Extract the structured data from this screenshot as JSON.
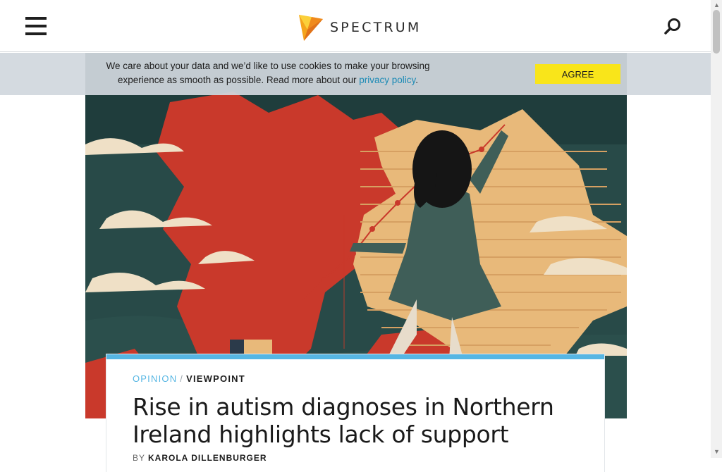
{
  "header": {
    "logo_text": "SPECTRUM",
    "menu_icon": "hamburger-menu-icon",
    "search_icon": "search-icon"
  },
  "cookie_banner": {
    "message_line1": "We care about your data and we’d like to use cookies to make your browsing",
    "message_line2_prefix": "experience as smooth as possible. Read more about our ",
    "link_text": "privacy policy",
    "message_suffix": ".",
    "agree_label": "AGREE"
  },
  "article": {
    "category": "OPINION",
    "separator": "/",
    "subcategory": "VIEWPOINT",
    "title": "Rise in autism diagnoses in Northern Ireland highlights lack of support",
    "byline_prefix": "BY",
    "author": "KAROLA DILLENBURGER",
    "hero_image": "illustration of a woman drawing a rising line graph over a map of Northern Ireland"
  },
  "colors": {
    "accent_blue": "#56b6e3",
    "agree_yellow": "#f9e51a",
    "logo_orange": "#f5a41c"
  }
}
